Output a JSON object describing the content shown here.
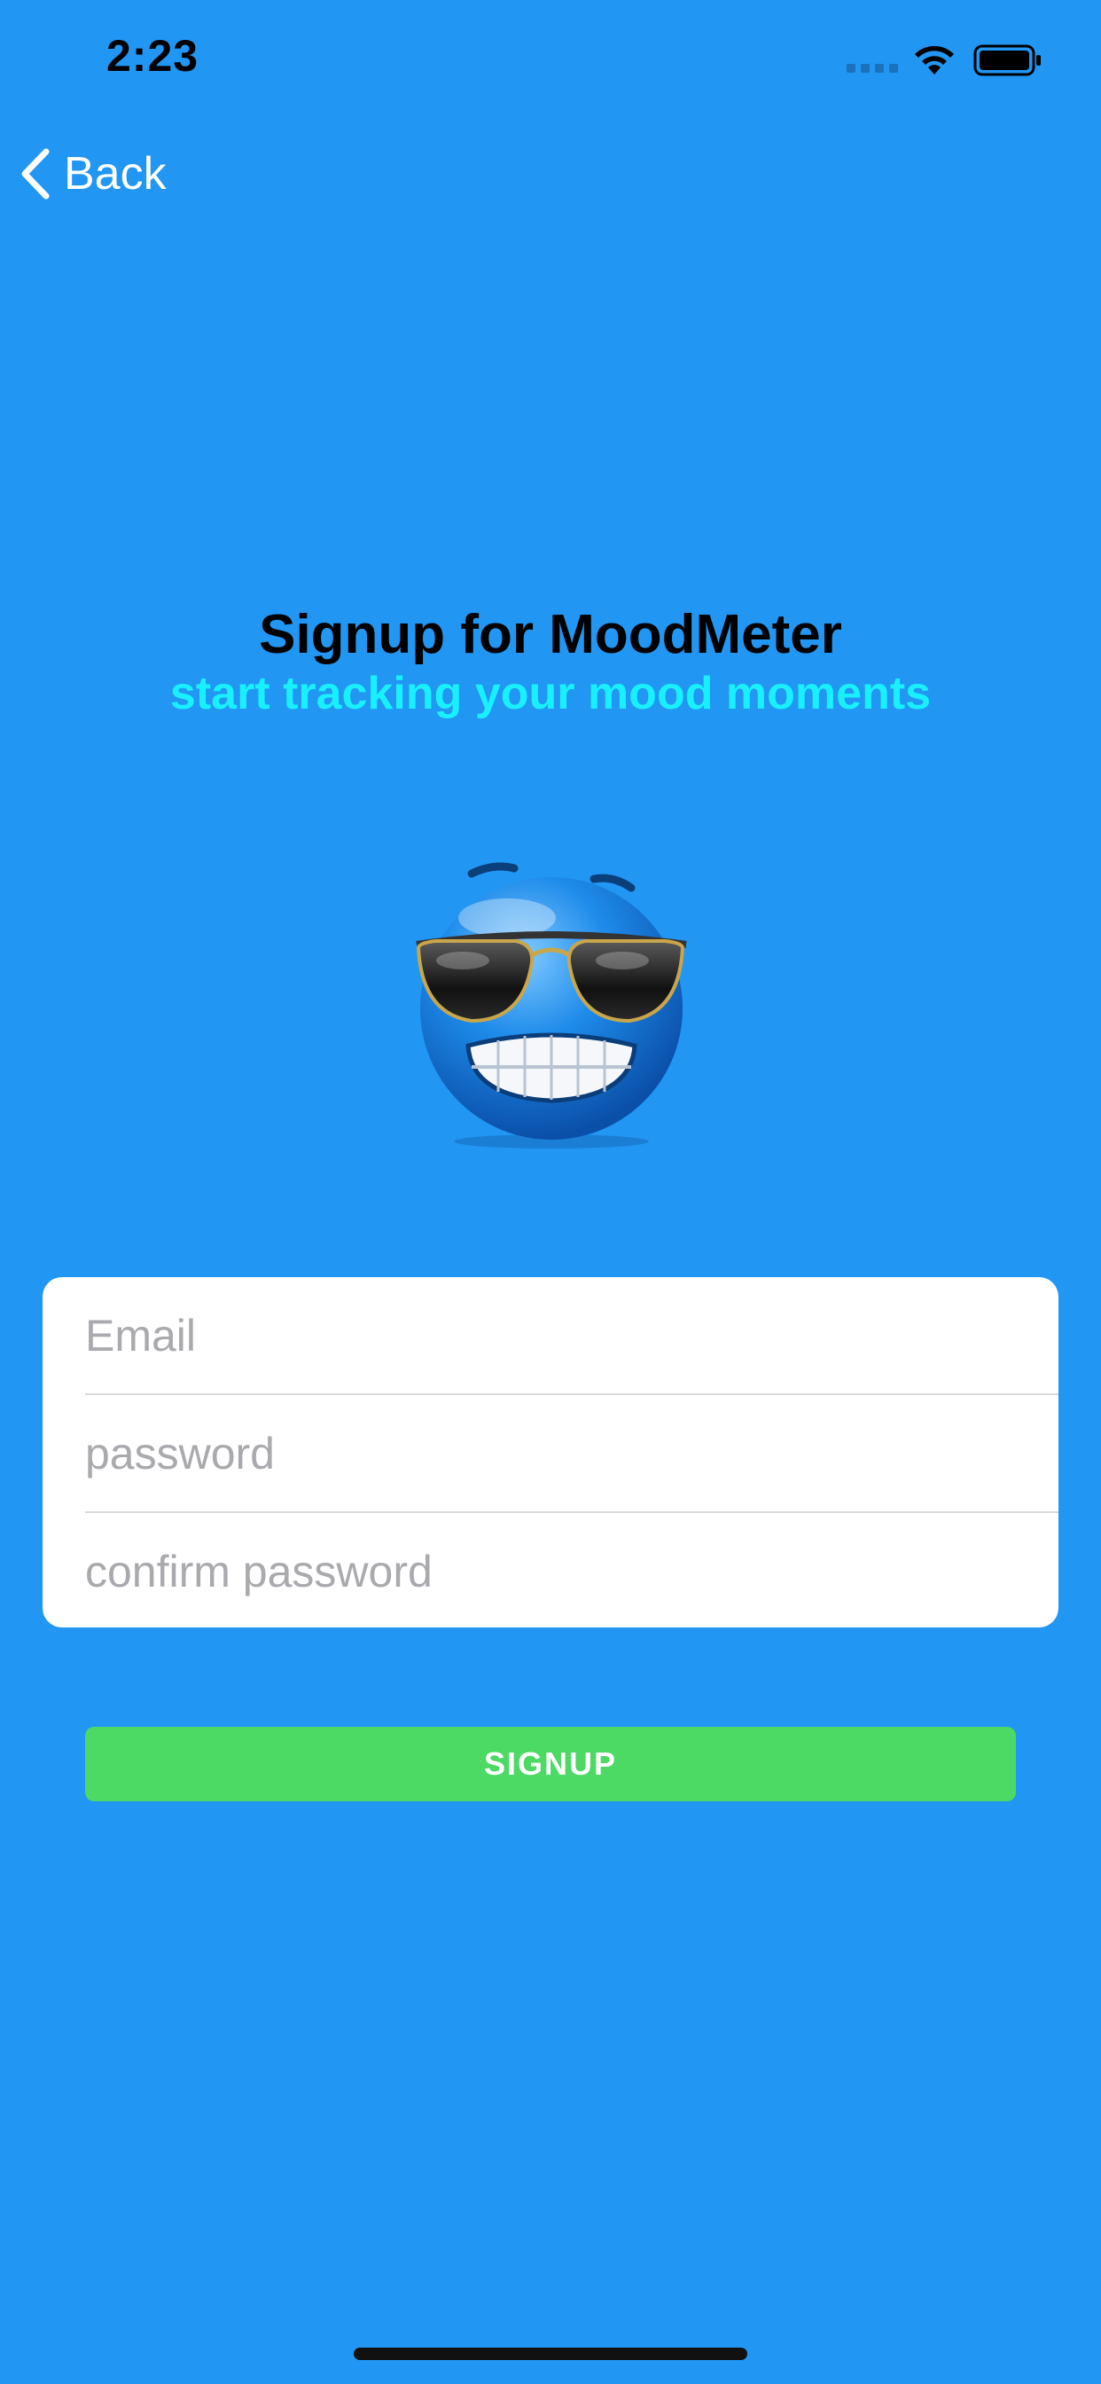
{
  "status_bar": {
    "time": "2:23",
    "icons": [
      "signal-icon",
      "wifi-icon",
      "battery-icon"
    ]
  },
  "nav": {
    "back_label": "Back",
    "back_icon": "chevron-left-icon"
  },
  "header": {
    "title": "Signup for MoodMeter",
    "subtitle": "start tracking your mood moments"
  },
  "mascot": {
    "icon": "sunglasses-emoji-icon"
  },
  "form": {
    "email": {
      "value": "",
      "placeholder": "Email"
    },
    "password": {
      "value": "",
      "placeholder": "password"
    },
    "confirm_password": {
      "value": "",
      "placeholder": "confirm password"
    }
  },
  "actions": {
    "signup_label": "SIGNUP"
  },
  "colors": {
    "background": "#2196F3",
    "subtitle": "#18F0FF",
    "signup_button": "#4CD964",
    "card": "#FFFFFF"
  }
}
